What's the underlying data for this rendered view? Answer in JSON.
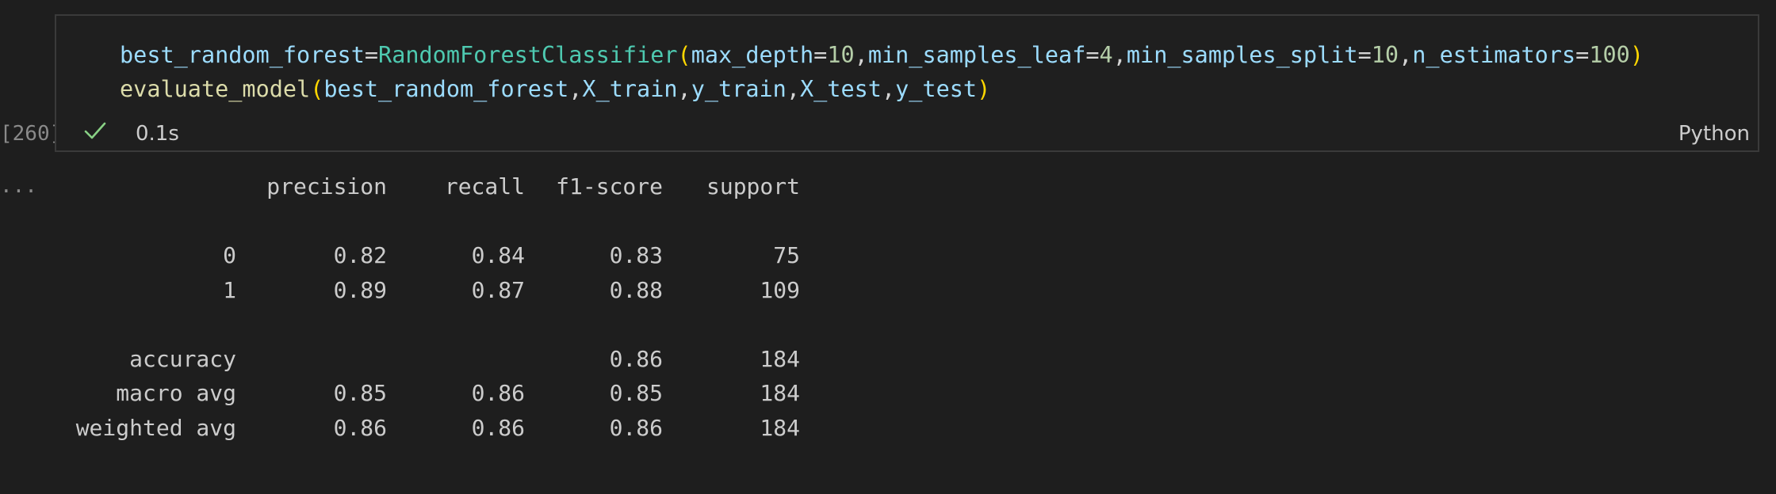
{
  "cell": {
    "execution_count": "[260]",
    "language": "Python",
    "status": {
      "icon": "check-icon",
      "duration": "0.1s",
      "color": "#89d185"
    },
    "code": {
      "line1": {
        "var": "best_random_forest",
        "eq": "=",
        "cls": "RandomForestClassifier",
        "open": "(",
        "k1": "max_depth",
        "e1": "=",
        "v1": "10",
        "c1": ",",
        "k2": "min_samples_leaf",
        "e2": "=",
        "v2": "4",
        "c2": ",",
        "k3": "min_samples_split",
        "e3": "=",
        "v3": "10",
        "c3": ",",
        "k4": "n_estimators",
        "e4": "=",
        "v4": "100",
        "close": ")"
      },
      "line2": {
        "fn": "evaluate_model",
        "open": "(",
        "a1": "best_random_forest",
        "c1": ",",
        "a2": "X_train",
        "c2": ",",
        "a3": "y_train",
        "c3": ",",
        "a4": "X_test",
        "c4": ",",
        "a5": "y_test",
        "close": ")"
      }
    }
  },
  "output": {
    "ellipsis": "...",
    "header": {
      "precision": "precision",
      "recall": "recall",
      "f1": "f1-score",
      "support": "support"
    },
    "rows": [
      {
        "label": "0",
        "precision": "0.82",
        "recall": "0.84",
        "f1": "0.83",
        "support": "75"
      },
      {
        "label": "1",
        "precision": "0.89",
        "recall": "0.87",
        "f1": "0.88",
        "support": "109"
      },
      {
        "label": "accuracy",
        "precision": "",
        "recall": "",
        "f1": "0.86",
        "support": "184"
      },
      {
        "label": "macro avg",
        "precision": "0.85",
        "recall": "0.86",
        "f1": "0.85",
        "support": "184"
      },
      {
        "label": "weighted avg",
        "precision": "0.86",
        "recall": "0.86",
        "f1": "0.86",
        "support": "184"
      }
    ]
  }
}
